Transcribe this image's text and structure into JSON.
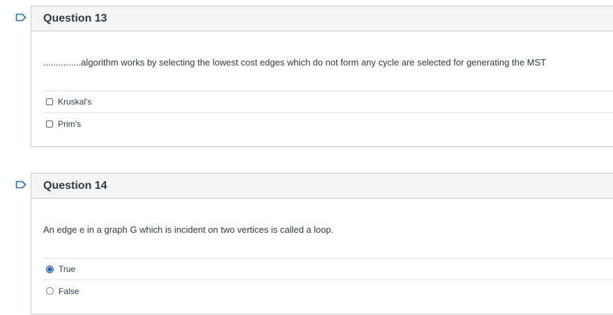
{
  "questions": [
    {
      "title": "Question 13",
      "text": "...............algorithm works by selecting the lowest cost edges which do not form any cycle are selected for generating the MST",
      "input_type": "checkbox",
      "answers": [
        {
          "label": "Kruskal's",
          "selected": false
        },
        {
          "label": "Prim's",
          "selected": false
        }
      ]
    },
    {
      "title": "Question 14",
      "text": "An edge e in a graph G which is incident on two vertices is called a loop.",
      "input_type": "radio",
      "answers": [
        {
          "label": "True",
          "selected": true
        },
        {
          "label": "False",
          "selected": false
        }
      ]
    }
  ],
  "colors": {
    "flag": "#1a6ec8",
    "selected_radio": "#1a6ec8",
    "border": "#c7cdd1",
    "header_bg": "#f5f5f5"
  },
  "icons": {
    "flag": "flag-icon"
  }
}
